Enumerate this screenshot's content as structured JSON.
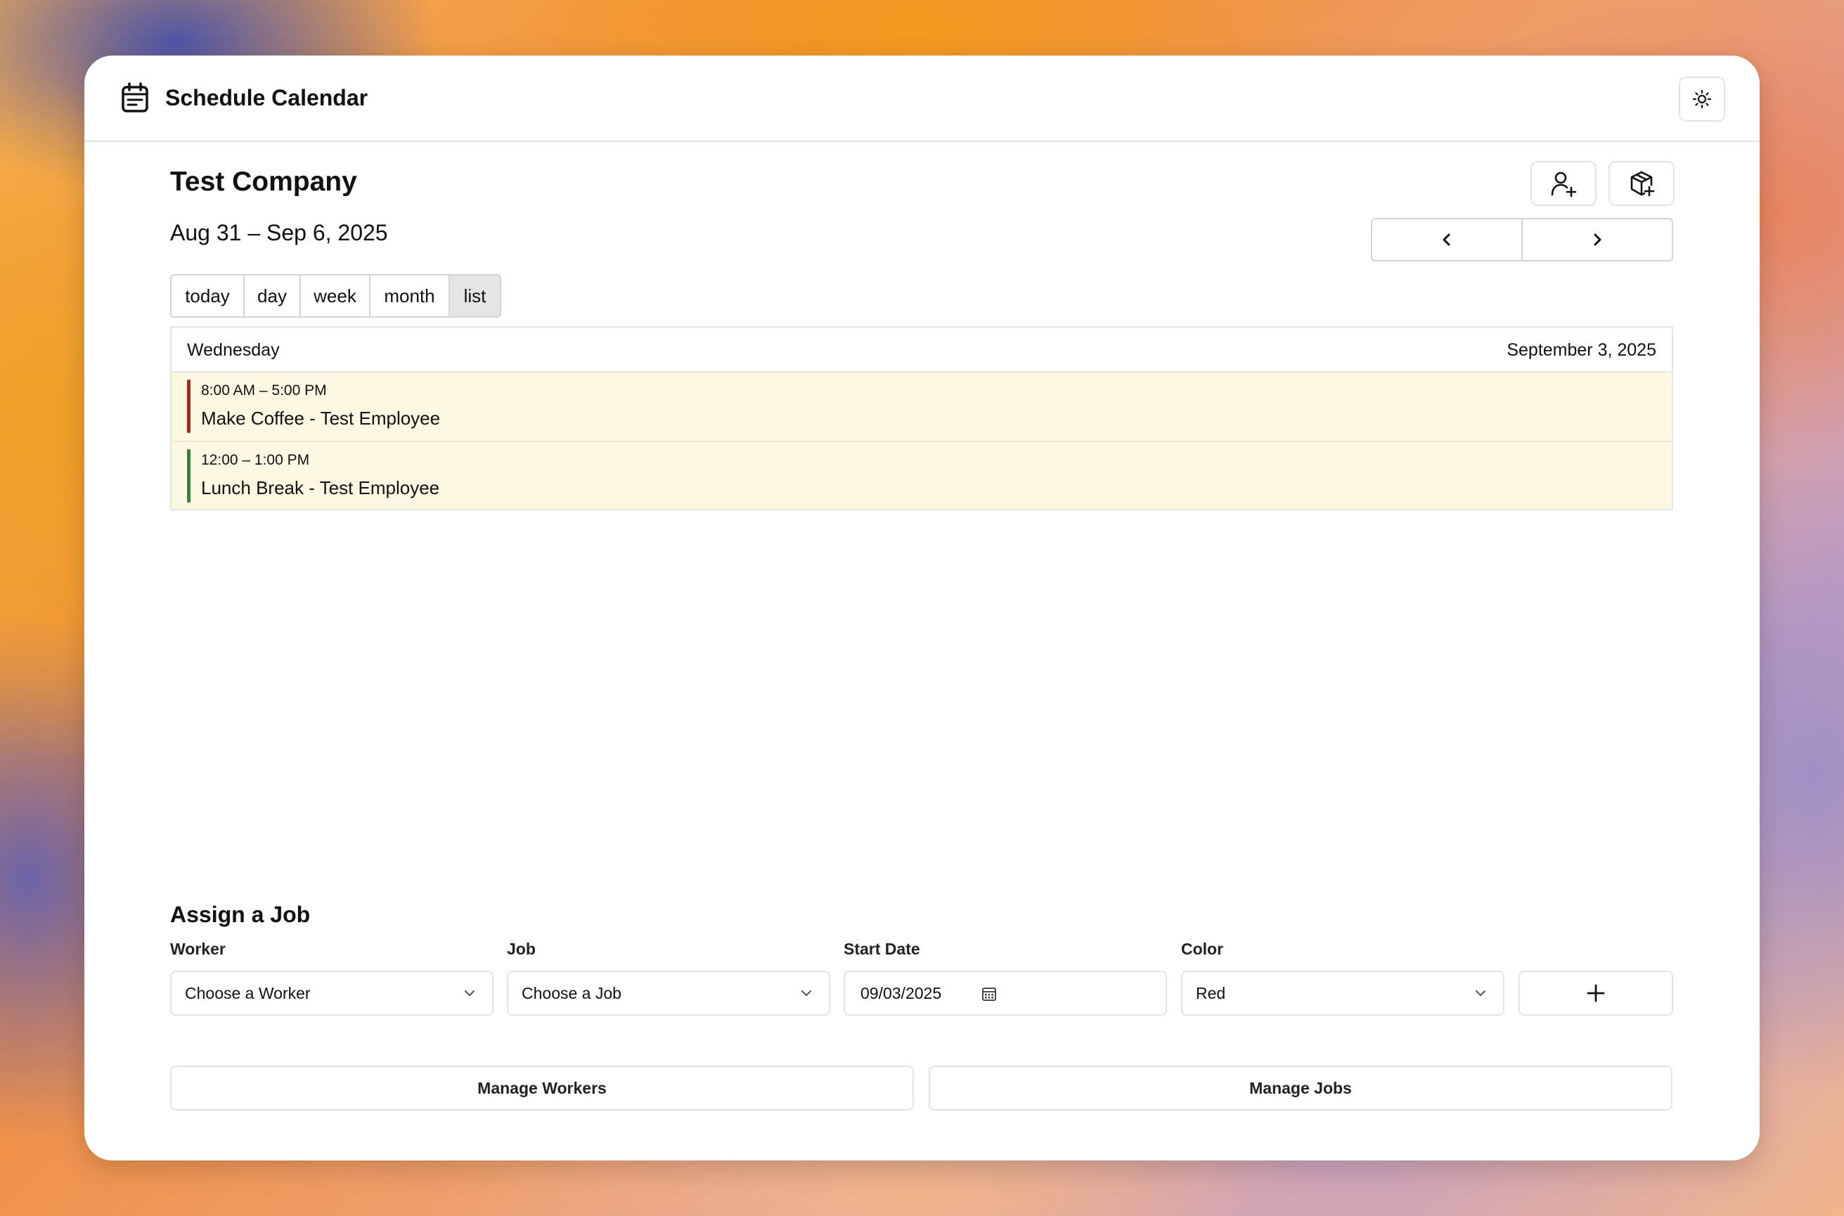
{
  "app": {
    "title": "Schedule Calendar",
    "icons": {
      "app": "calendar-icon",
      "theme": "sun-icon"
    }
  },
  "header": {
    "company": "Test Company",
    "date_range": "Aug 31 – Sep 6, 2025",
    "actions": {
      "add_worker_icon": "user-plus-icon",
      "add_job_icon": "package-plus-icon"
    },
    "nav": {
      "prev": "‹",
      "next": "›"
    }
  },
  "views": [
    {
      "label": "today",
      "active": false
    },
    {
      "label": "day",
      "active": false
    },
    {
      "label": "week",
      "active": false
    },
    {
      "label": "month",
      "active": false
    },
    {
      "label": "list",
      "active": true
    }
  ],
  "list": {
    "day_name": "Wednesday",
    "date": "September 3, 2025",
    "events": [
      {
        "time": "8:00 AM – 5:00 PM",
        "title": "Make Coffee - Test Employee",
        "color": "#9b2c1f"
      },
      {
        "time": "12:00 – 1:00 PM",
        "title": "Lunch Break - Test Employee",
        "color": "#3f7d3a"
      }
    ]
  },
  "assign": {
    "title": "Assign a Job",
    "worker_label": "Worker",
    "worker_value": "Choose a Worker",
    "job_label": "Job",
    "job_value": "Choose a Job",
    "start_label": "Start Date",
    "start_value": "09/03/2025",
    "color_label": "Color",
    "color_value": "Red",
    "add_icon": "plus-icon"
  },
  "manage": {
    "workers": "Manage Workers",
    "jobs": "Manage Jobs"
  }
}
